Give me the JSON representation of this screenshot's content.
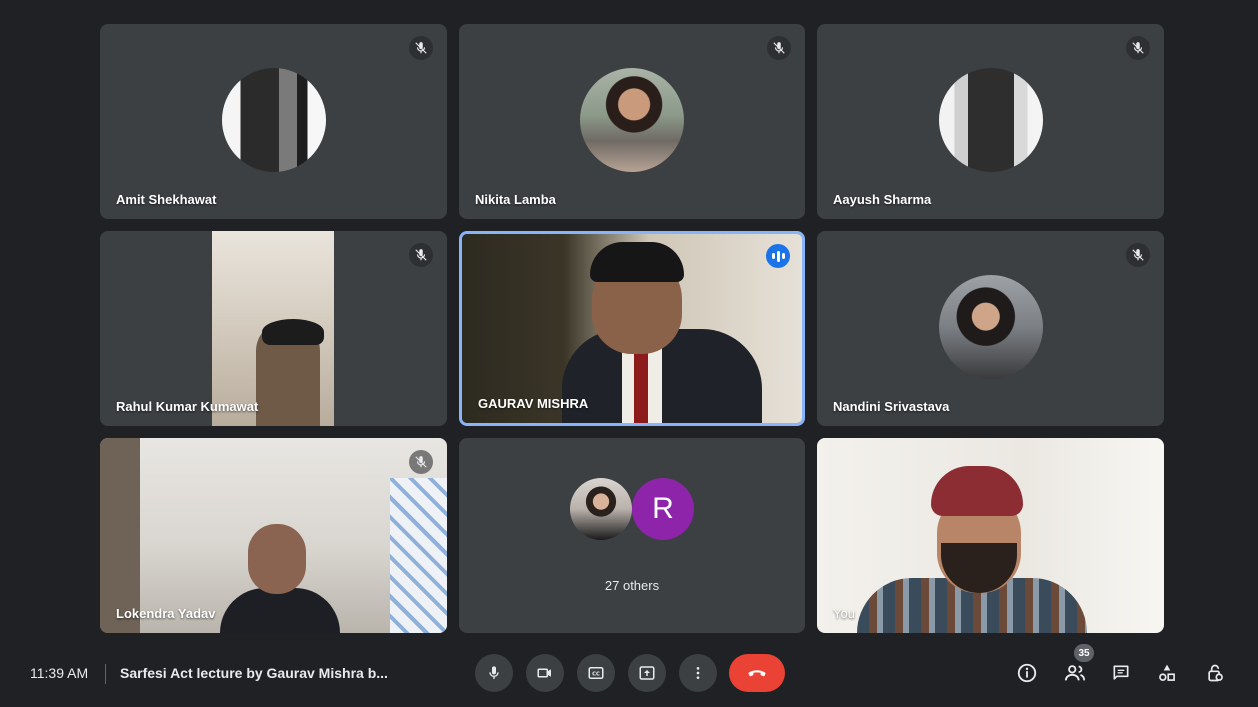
{
  "participants": [
    {
      "name": "Amit Shekhawat"
    },
    {
      "name": "Nikita Lamba"
    },
    {
      "name": "Aayush Sharma"
    },
    {
      "name": "Rahul Kumar Kumawat"
    },
    {
      "name": "GAURAV MISHRA"
    },
    {
      "name": "Nandini Srivastava"
    },
    {
      "name": "Lokendra Yadav"
    },
    {
      "name": "You"
    }
  ],
  "others": {
    "label": "27 others",
    "initial": "R",
    "initial_color": "#8e24aa"
  },
  "bar": {
    "time": "11:39 AM",
    "meeting_title": "Sarfesi Act lecture by Gaurav Mishra b...",
    "participant_count": "35"
  },
  "colors": {
    "speaking_border": "#8ab4f8",
    "end_call": "#ea4335",
    "tile_bg": "#3c4043",
    "page_bg": "#202124"
  }
}
